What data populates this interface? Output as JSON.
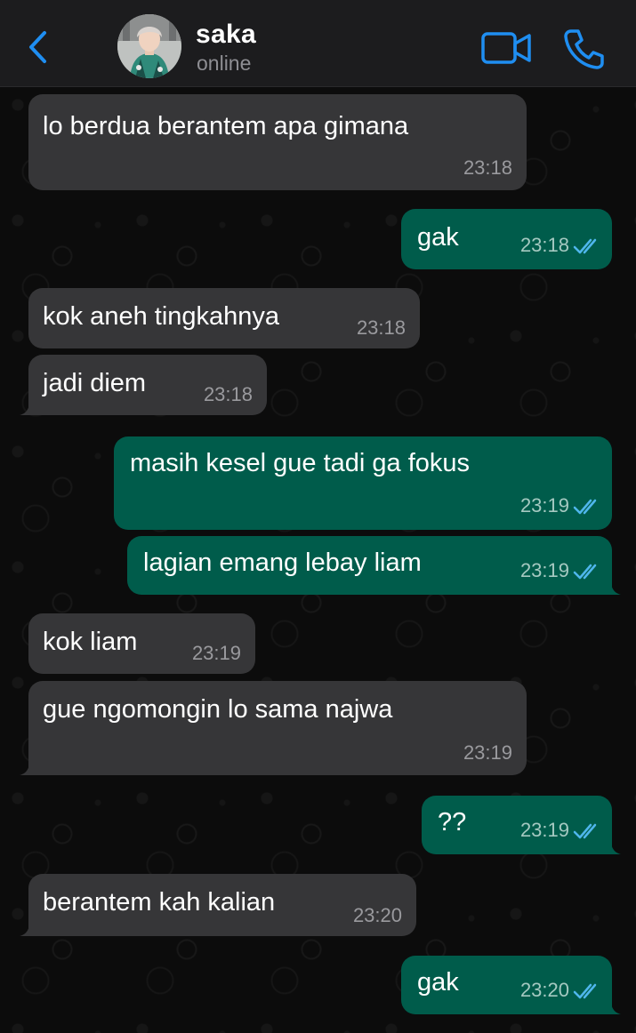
{
  "header": {
    "contact_name": "saka",
    "status": "online",
    "back_icon": "chevron-left-icon",
    "video_icon": "video-camera-icon",
    "call_icon": "phone-icon"
  },
  "colors": {
    "accent": "#1f8ef1",
    "incoming_bubble": "#363638",
    "outgoing_bubble": "#005c4b",
    "read_ticks": "#4fb6ec"
  },
  "messages": [
    {
      "direction": "incoming",
      "text": "lo berdua berantem apa gimana",
      "time": "23:18"
    },
    {
      "direction": "outgoing",
      "text": "gak",
      "time": "23:18",
      "status": "read"
    },
    {
      "direction": "incoming",
      "text": "kok aneh tingkahnya",
      "time": "23:18"
    },
    {
      "direction": "incoming",
      "text": "jadi diem",
      "time": "23:18"
    },
    {
      "direction": "outgoing",
      "text": "masih kesel gue tadi ga fokus",
      "time": "23:19",
      "status": "read"
    },
    {
      "direction": "outgoing",
      "text": "lagian emang lebay liam",
      "time": "23:19",
      "status": "read"
    },
    {
      "direction": "incoming",
      "text": "kok liam",
      "time": "23:19"
    },
    {
      "direction": "incoming",
      "text": "gue ngomongin lo sama najwa",
      "time": "23:19"
    },
    {
      "direction": "outgoing",
      "text": "??",
      "time": "23:19",
      "status": "read"
    },
    {
      "direction": "incoming",
      "text": "berantem kah kalian",
      "time": "23:20"
    },
    {
      "direction": "outgoing",
      "text": "gak",
      "time": "23:20",
      "status": "read"
    }
  ]
}
